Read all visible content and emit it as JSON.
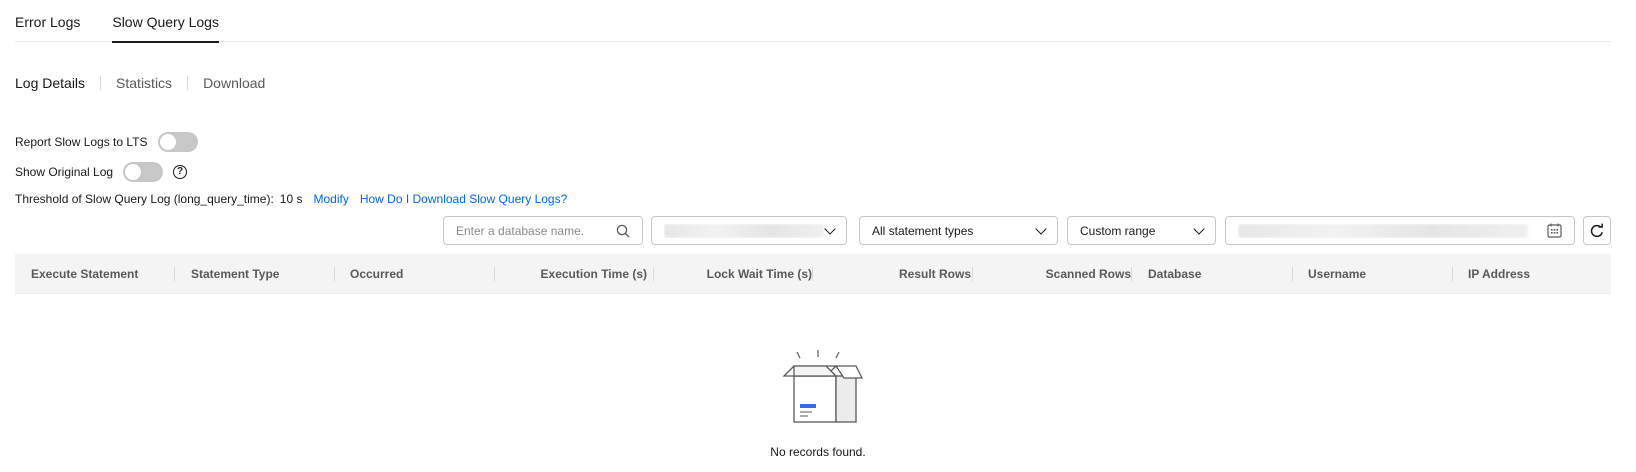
{
  "top_tabs": [
    "Error Logs",
    "Slow Query Logs"
  ],
  "top_tabs_active": "Slow Query Logs",
  "sub_tabs": [
    "Log Details",
    "Statistics",
    "Download"
  ],
  "settings": {
    "report_label": "Report Slow Logs to LTS",
    "report_enabled": false,
    "show_original_label": "Show Original Log",
    "show_original_enabled": false,
    "help_icon": "question-circle-icon",
    "threshold_label": "Threshold of Slow Query Log (long_query_time):",
    "threshold_value": "10 s",
    "modify_link": "Modify",
    "download_help_link": "How Do I Download Slow Query Logs?"
  },
  "filters": {
    "search_placeholder": "Enter a database name.",
    "statement_type": "All statement types",
    "time_range": "Custom range"
  },
  "table": {
    "columns": [
      "Execute Statement",
      "Statement Type",
      "Occurred",
      "Execution Time (s)",
      "Lock Wait Time (s)",
      "Result Rows",
      "Scanned Rows",
      "Database",
      "Username",
      "IP Address"
    ],
    "rows": []
  },
  "empty_state": {
    "icon": "empty-box-icon",
    "message": "No records found."
  },
  "colors": {
    "link": "#0066ff",
    "toggle_off": "#c7c7c7",
    "header_bg": "#f4f4f4"
  }
}
